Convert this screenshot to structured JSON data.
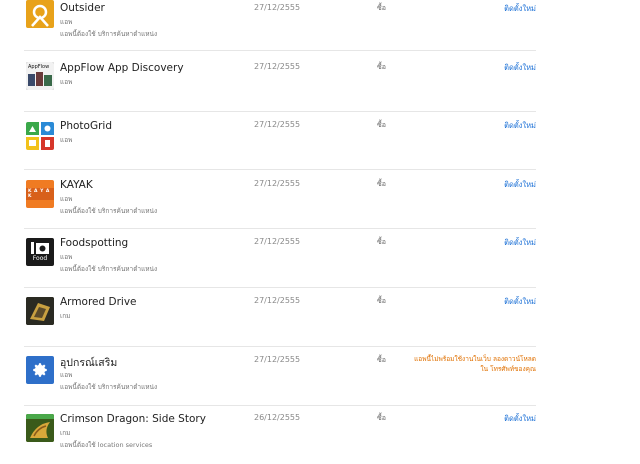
{
  "rows": [
    {
      "title": "Outsider",
      "category": "แอพ",
      "note": "แอพนี้ต้องใช้ บริการค้นหาตำแหน่ง",
      "date": "27/12/2555",
      "type": "ซื้อ",
      "action": "ติดตั้งใหม่",
      "icon": "outsider-icon",
      "icon_bg": "#e8a21a"
    },
    {
      "title": "AppFlow App Discovery",
      "category": "แอพ",
      "note": "",
      "date": "27/12/2555",
      "type": "ซื้อ",
      "action": "ติดตั้งใหม่",
      "icon": "appflow-icon",
      "icon_bg": "#222222"
    },
    {
      "title": "PhotoGrid",
      "category": "แอพ",
      "note": "",
      "date": "27/12/2555",
      "type": "ซื้อ",
      "action": "ติดตั้งใหม่",
      "icon": "photogrid-icon",
      "icon_bg": "#ffffff"
    },
    {
      "title": "KAYAK",
      "category": "แอพ",
      "note": "แอพนี้ต้องใช้ บริการค้นหาตำแหน่ง",
      "date": "27/12/2555",
      "type": "ซื้อ",
      "action": "ติดตั้งใหม่",
      "icon": "kayak-icon",
      "icon_bg": "#f07b22"
    },
    {
      "title": "Foodspotting",
      "category": "แอพ",
      "note": "แอพนี้ต้องใช้ บริการค้นหาตำแหน่ง",
      "date": "27/12/2555",
      "type": "ซื้อ",
      "action": "ติดตั้งใหม่",
      "icon": "foodspotting-icon",
      "icon_bg": "#1a1a1a"
    },
    {
      "title": "Armored Drive",
      "category": "เกม",
      "note": "",
      "date": "27/12/2555",
      "type": "ซื้อ",
      "action": "ติดตั้งใหม่",
      "icon": "armored-drive-icon",
      "icon_bg": "#3a3a2a"
    },
    {
      "title": "อุปกรณ์เสริม",
      "category": "แอพ",
      "note": "แอพนี้ต้องใช้ บริการค้นหาตำแหน่ง",
      "date": "27/12/2555",
      "type": "ซื้อ",
      "action": "",
      "warning": "แอพนี้ไม่พร้อมใช้งานในเว็บ ลองดาวน์โหลดใน โทรศัพท์ของคุณ",
      "icon": "gear-icon",
      "icon_bg": "#2e6fc9"
    },
    {
      "title": "Crimson Dragon: Side Story",
      "category": "เกม",
      "note": "แอพนี้ต้องใช้ location services",
      "date": "26/12/2555",
      "type": "ซื้อ",
      "action": "ติดตั้งใหม่",
      "icon": "crimson-dragon-icon",
      "icon_bg": "#6a8a2a"
    }
  ],
  "icon_labels": {
    "appflow": "AppFlow",
    "kayak": "K A Y A K",
    "food": "Food"
  },
  "colors": {
    "link": "#1a6fd6",
    "warning": "#e07000"
  }
}
